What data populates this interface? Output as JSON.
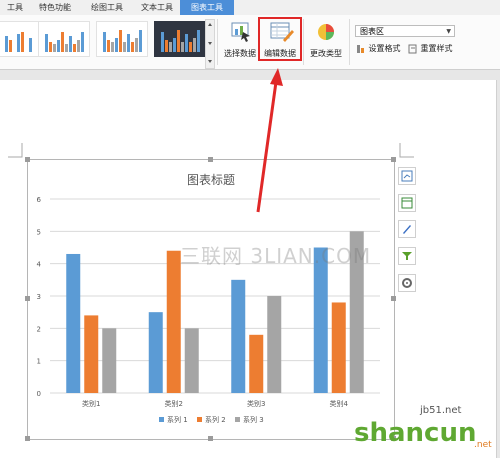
{
  "tabs": [
    {
      "label": "工具",
      "active": false
    },
    {
      "label": "特色功能",
      "active": false
    },
    {
      "label": "绘图工具",
      "active": false
    },
    {
      "label": "文本工具",
      "active": false
    },
    {
      "label": "图表工具",
      "active": true
    }
  ],
  "ribbon": {
    "select_data": "选择数据",
    "edit_data": "编辑数据",
    "change_type": "更改类型",
    "chart_area_select": "图表区",
    "set_format": "设置格式",
    "reset_style": "重置样式"
  },
  "chart_data": {
    "type": "bar",
    "title": "图表标题",
    "categories": [
      "类别1",
      "类别2",
      "类别3",
      "类别4"
    ],
    "series": [
      {
        "name": "系列 1",
        "values": [
          4.3,
          2.5,
          3.5,
          4.5
        ]
      },
      {
        "name": "系列 2",
        "values": [
          2.4,
          4.4,
          1.8,
          2.8
        ]
      },
      {
        "name": "系列 3",
        "values": [
          2,
          2,
          3,
          5
        ]
      }
    ],
    "yticks": [
      "0",
      "1",
      "2",
      "3",
      "4",
      "5",
      "6"
    ],
    "ylim": [
      0,
      6
    ],
    "grid": true,
    "legend": "bottom",
    "colors": [
      "#5b9bd5",
      "#ed7d31",
      "#a5a5a5"
    ]
  },
  "watermarks": {
    "center": "三联网 3LIAN.COM",
    "jb51": "jb51.net",
    "shancun": "shancun",
    "shancun_suffix": ".net"
  }
}
